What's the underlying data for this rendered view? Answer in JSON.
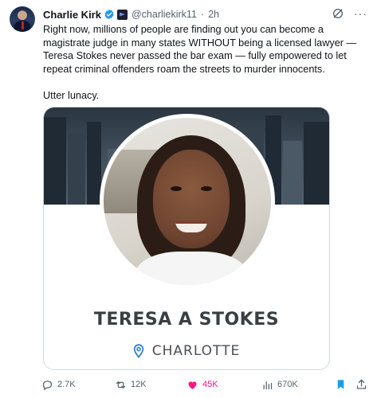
{
  "post": {
    "author_name": "Charlie Kirk",
    "handle": "@charliekirk11",
    "separator": "·",
    "time": "2h",
    "more": "···",
    "text_para1": "Right now, millions of people are finding out you can become a magistrate judge in many states WITHOUT being a licensed lawyer — Teresa Stokes never passed the bar exam — fully empowered to let repeat criminal offenders roam the streets to murder innocents.",
    "text_para2": "Utter lunacy."
  },
  "card": {
    "name": "TERESA A STOKES",
    "location": "CHARLOTTE"
  },
  "actions": {
    "replies": "2.7K",
    "reposts": "12K",
    "likes": "45K",
    "views": "670K"
  },
  "colors": {
    "verified": "#1d9bf0",
    "like": "#f91880",
    "bookmark": "#1d9bf0",
    "muted": "#536471",
    "card_border": "#cfd9de"
  },
  "icons": [
    "verified-badge-icon",
    "affiliation-badge-icon",
    "grok-icon",
    "more-icon",
    "location-pin-icon",
    "reply-icon",
    "repost-icon",
    "like-icon",
    "views-icon",
    "bookmark-icon",
    "share-icon"
  ]
}
